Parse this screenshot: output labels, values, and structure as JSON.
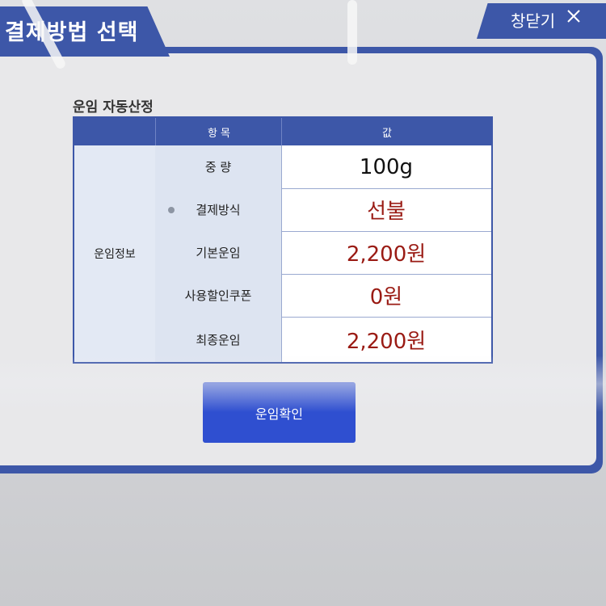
{
  "window": {
    "title": "결제방법 선택",
    "close_label": "창닫기"
  },
  "section_title": "운임 자동산정",
  "table": {
    "headers": [
      "항 목",
      "값"
    ],
    "group_label": "운임정보",
    "rows": [
      {
        "label": "중 량",
        "value": "100g"
      },
      {
        "label": "결제방식",
        "value": "선불"
      },
      {
        "label": "기본운임",
        "value": "2,200원"
      },
      {
        "label": "사용할인쿠폰",
        "value": "0원"
      },
      {
        "label": "최종운임",
        "value": "2,200원"
      }
    ]
  },
  "confirm_button": "운임확인",
  "colors": {
    "frame_blue": "#3d57a8",
    "button_blue": "#2f4fd0",
    "value_red": "#9a1b14"
  }
}
